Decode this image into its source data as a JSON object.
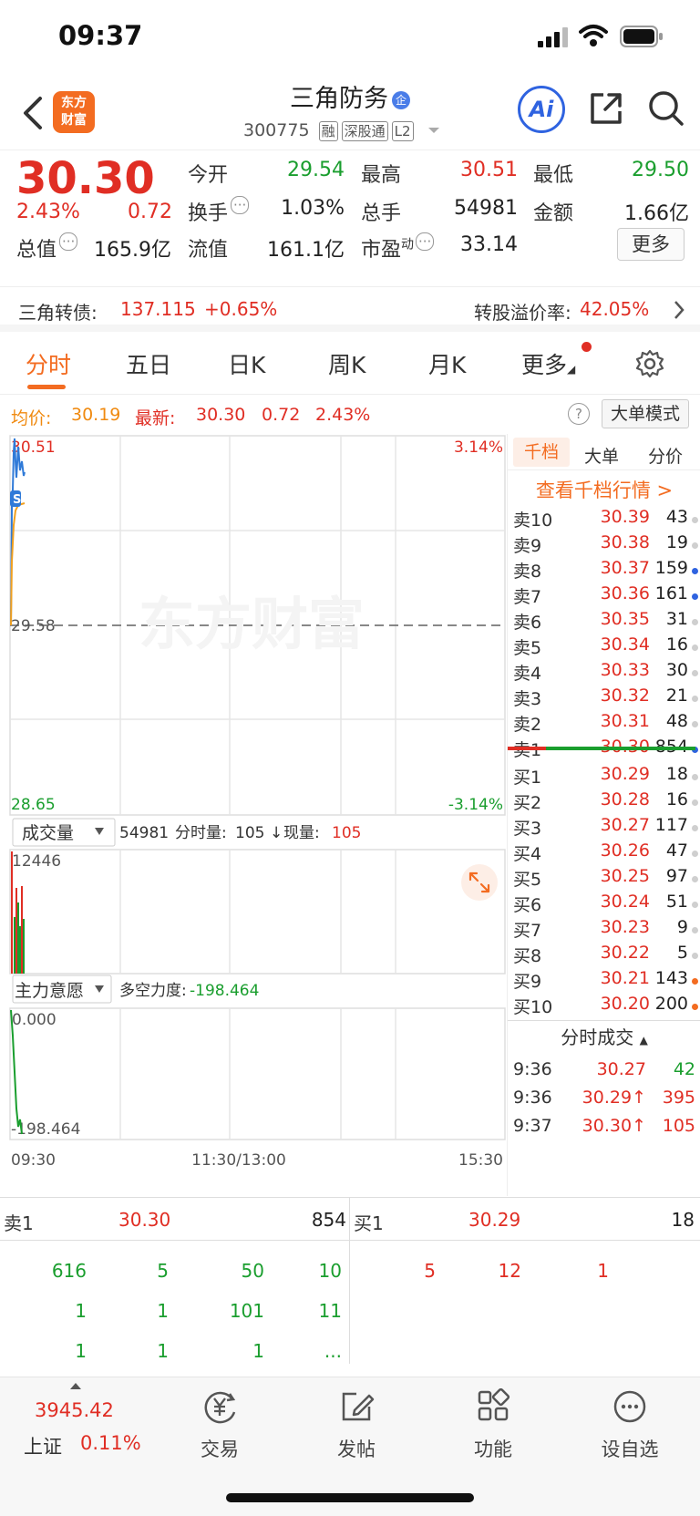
{
  "status": {
    "time": "09:37"
  },
  "header": {
    "logo_line1": "东方",
    "logo_line2": "财富",
    "name": "三角防务",
    "name_badge": "企",
    "code": "300775",
    "tags": [
      "融",
      "深股通",
      "L2"
    ],
    "ai_label": "Ai"
  },
  "quote": {
    "price": "30.30",
    "change_pct": "2.43%",
    "change_amt": "0.72",
    "fields": [
      {
        "label": "今开",
        "value": "29.54",
        "color": "green"
      },
      {
        "label": "最高",
        "value": "30.51",
        "color": "red"
      },
      {
        "label": "最低",
        "value": "29.50",
        "color": "green"
      },
      {
        "label": "换手",
        "value": "1.03%",
        "color": "dark"
      },
      {
        "label": "总手",
        "value": "54981",
        "color": "dark"
      },
      {
        "label": "金额",
        "value": "1.66亿",
        "color": "dark"
      },
      {
        "label": "总值",
        "value": "165.9亿",
        "color": "dark"
      },
      {
        "label": "流值",
        "value": "161.1亿",
        "color": "dark"
      },
      {
        "label": "市盈",
        "value": "33.14",
        "color": "dark"
      }
    ],
    "pe_sup": "动",
    "more_label": "更多"
  },
  "convertible": {
    "label": "三角转债:",
    "price": "137.115",
    "change": "+0.65%",
    "premium_label": "转股溢价率:",
    "premium": "42.05%"
  },
  "tabs": [
    "分时",
    "五日",
    "日K",
    "周K",
    "月K",
    "更多"
  ],
  "avg_row": {
    "avg_label": "均价:",
    "avg": "30.19",
    "latest_label": "最新:",
    "latest": "30.30",
    "chg": "0.72",
    "pct": "2.43%",
    "big_order_label": "大单模式"
  },
  "chart": {
    "top_price": "30.51",
    "top_pct": "3.14%",
    "mid_price": "29.58",
    "bottom_price": "28.65",
    "bottom_pct": "-3.14%",
    "watermark": "东方财富",
    "vol_selector": "成交量",
    "vol_total": "54981",
    "vol_minute_label": "分时量:",
    "vol_minute": "105",
    "vol_now_label": "现量:",
    "vol_now": "105",
    "vol_max": "12446",
    "ind_selector": "主力意愿",
    "ind_label": "多空力度:",
    "ind_value": "-198.464",
    "ind_top": "0.000",
    "ind_bottom": "-198.464",
    "time_start": "09:30",
    "time_mid": "11:30/13:00",
    "time_end": "15:30"
  },
  "orderbook": {
    "tabs": [
      "千档",
      "大单",
      "分价"
    ],
    "link": "查看千档行情 >",
    "asks": [
      {
        "lv": "卖10",
        "p": "30.39",
        "v": "43",
        "dot": "#cfcfcf"
      },
      {
        "lv": "卖9",
        "p": "30.38",
        "v": "19",
        "dot": "#cfcfcf"
      },
      {
        "lv": "卖8",
        "p": "30.37",
        "v": "159",
        "dot": "#2f63e0"
      },
      {
        "lv": "卖7",
        "p": "30.36",
        "v": "161",
        "dot": "#2f63e0"
      },
      {
        "lv": "卖6",
        "p": "30.35",
        "v": "31",
        "dot": "#cfcfcf"
      },
      {
        "lv": "卖5",
        "p": "30.34",
        "v": "16",
        "dot": "#cfcfcf"
      },
      {
        "lv": "卖4",
        "p": "30.33",
        "v": "30",
        "dot": "#cfcfcf"
      },
      {
        "lv": "卖3",
        "p": "30.32",
        "v": "21",
        "dot": "#cfcfcf"
      },
      {
        "lv": "卖2",
        "p": "30.31",
        "v": "48",
        "dot": "#cfcfcf"
      },
      {
        "lv": "卖1",
        "p": "30.30",
        "v": "854",
        "dot": "#2f63e0"
      }
    ],
    "bids": [
      {
        "lv": "买1",
        "p": "30.29",
        "v": "18",
        "dot": "#cfcfcf"
      },
      {
        "lv": "买2",
        "p": "30.28",
        "v": "16",
        "dot": "#cfcfcf"
      },
      {
        "lv": "买3",
        "p": "30.27",
        "v": "117",
        "dot": "#cfcfcf"
      },
      {
        "lv": "买4",
        "p": "30.26",
        "v": "47",
        "dot": "#cfcfcf"
      },
      {
        "lv": "买5",
        "p": "30.25",
        "v": "97",
        "dot": "#cfcfcf"
      },
      {
        "lv": "买6",
        "p": "30.24",
        "v": "51",
        "dot": "#cfcfcf"
      },
      {
        "lv": "买7",
        "p": "30.23",
        "v": "9",
        "dot": "#cfcfcf"
      },
      {
        "lv": "买8",
        "p": "30.22",
        "v": "5",
        "dot": "#cfcfcf"
      },
      {
        "lv": "买9",
        "p": "30.21",
        "v": "143",
        "dot": "#f36c21"
      },
      {
        "lv": "买10",
        "p": "30.20",
        "v": "200",
        "dot": "#f36c21"
      }
    ],
    "trades_label": "分时成交",
    "trades": [
      {
        "t": "9:36",
        "p": "30.27",
        "v": "42",
        "vc": "green"
      },
      {
        "t": "9:36",
        "p": "30.29↑",
        "v": "395",
        "vc": "red"
      },
      {
        "t": "9:37",
        "p": "30.30↑",
        "v": "105",
        "vc": "red"
      }
    ]
  },
  "level1": {
    "ask_label": "卖1",
    "ask_price": "30.30",
    "ask_vol": "854",
    "bid_label": "买1",
    "bid_price": "30.29",
    "bid_vol": "18"
  },
  "queue": {
    "ask": [
      [
        "616",
        "5",
        "50",
        "10"
      ],
      [
        "1",
        "1",
        "101",
        "11"
      ],
      [
        "1",
        "1",
        "1",
        "..."
      ]
    ],
    "bid": [
      [
        "5",
        "12",
        "1"
      ]
    ]
  },
  "tabbar": {
    "index_value": "3945.42",
    "index_name": "上证",
    "index_pct": "0.11%",
    "items": [
      "交易",
      "发帖",
      "功能",
      "设自选"
    ]
  }
}
